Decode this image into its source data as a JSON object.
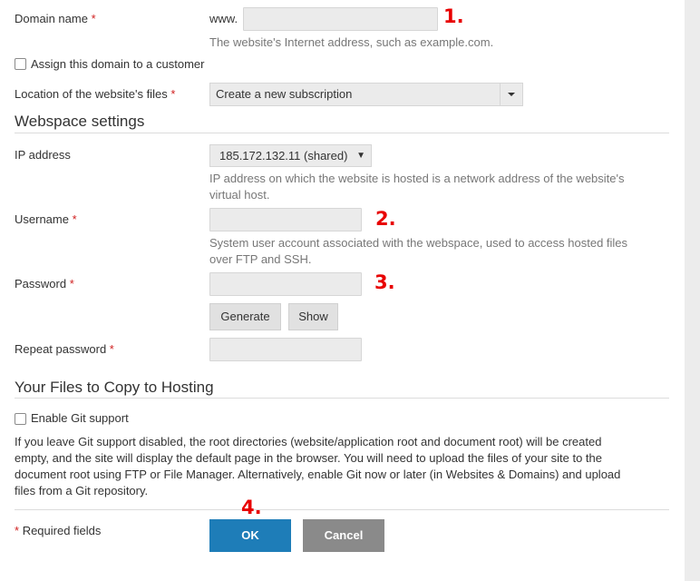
{
  "domain": {
    "label": "Domain name",
    "required_mark": "*",
    "prefix": "www.",
    "value": "",
    "hint": "The website's Internet address, such as example.com."
  },
  "assign_customer": {
    "label": "Assign this domain to a customer",
    "checked": false
  },
  "location": {
    "label": "Location of the website's files",
    "required_mark": "*",
    "selected": "Create a new subscription"
  },
  "webspace": {
    "title": "Webspace settings",
    "ip": {
      "label": "IP address",
      "selected": "185.172.132.11 (shared)",
      "hint_line1": "IP address on which the website is hosted is a network address of the website's",
      "hint_line2": "virtual host."
    },
    "username": {
      "label": "Username",
      "required_mark": "*",
      "value": "",
      "hint_line1": "System user account associated with the webspace, used to access hosted files",
      "hint_line2": "over FTP and SSH."
    },
    "password": {
      "label": "Password",
      "required_mark": "*",
      "value": "",
      "generate_label": "Generate",
      "show_label": "Show"
    },
    "repeat_password": {
      "label": "Repeat password",
      "required_mark": "*",
      "value": ""
    }
  },
  "files": {
    "title": "Your Files to Copy to Hosting",
    "git": {
      "label": "Enable Git support",
      "checked": false
    },
    "paragraph_lines": [
      "If you leave Git support disabled, the root directories (website/application root and document root) will be created",
      "empty, and the site will display the default page in the browser. You will need to upload the files of your site to the",
      "document root using FTP or File Manager. Alternatively, enable Git now or later (in Websites & Domains) and upload",
      "files from a Git repository."
    ]
  },
  "footer": {
    "required_mark": "*",
    "required_text": "Required fields",
    "ok_label": "OK",
    "cancel_label": "Cancel"
  },
  "annotations": [
    "1.",
    "2.",
    "3.",
    "4."
  ],
  "colors": {
    "accent": "#1e7db8",
    "annotation": "#e80000",
    "required": "#d02020",
    "cancel": "#8a8a8a"
  }
}
